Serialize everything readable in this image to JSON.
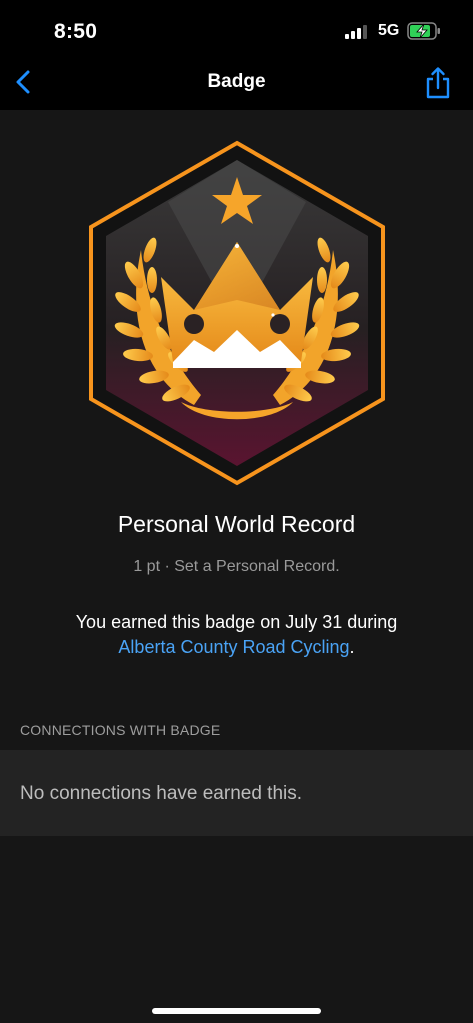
{
  "status_bar": {
    "time": "8:50",
    "network": "5G",
    "battery_color": "#30d158"
  },
  "nav": {
    "title": "Badge",
    "back_icon": "chevron-left-icon",
    "share_icon": "share-icon",
    "accent": "#1e8fff"
  },
  "badge": {
    "icon": "crown-laurel-badge-icon",
    "title": "Personal World Record",
    "subtitle": "1 pt · Set a Personal Record.",
    "earned_prefix": "You earned this badge on July 31 during",
    "earned_link": "Alberta County Road Cycling",
    "earned_suffix": ".",
    "link_color": "#4aa3f5",
    "frame_color": "#f7941d"
  },
  "connections": {
    "header": "CONNECTIONS WITH BADGE",
    "empty_text": "No connections have earned this."
  }
}
